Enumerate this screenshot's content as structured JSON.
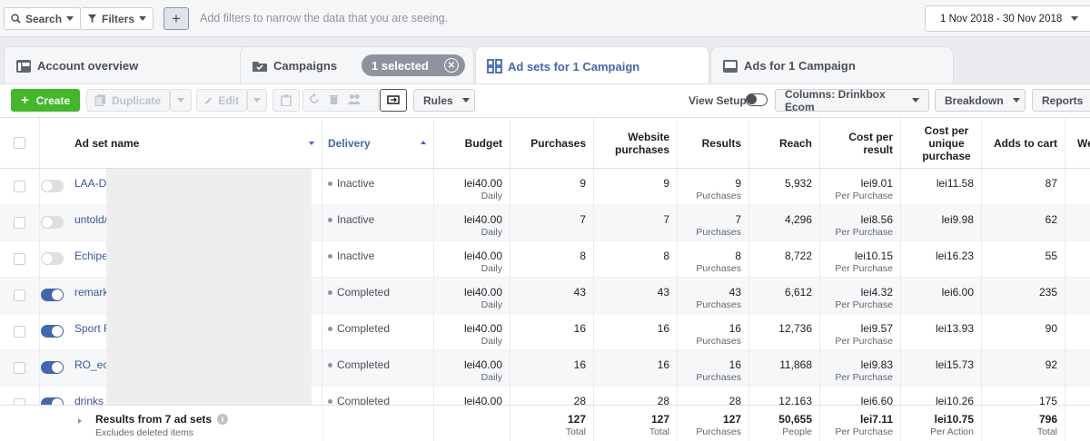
{
  "filterbar": {
    "search_label": "Search",
    "filters_label": "Filters",
    "add_label": "+",
    "hint": "Add filters to narrow the data that you are seeing.",
    "date_range": "1 Nov 2018 - 30 Nov 2018"
  },
  "tabs": {
    "account": "Account overview",
    "campaigns": "Campaigns",
    "selected": "1 selected",
    "adsets": "Ad sets for 1 Campaign",
    "ads": "Ads for 1 Campaign"
  },
  "toolbar": {
    "create": "Create",
    "duplicate": "Duplicate",
    "edit": "Edit",
    "rules": "Rules",
    "view_setup": "View Setup",
    "columns": "Columns: Drinkbox Ecom",
    "breakdown": "Breakdown",
    "reports": "Reports"
  },
  "columns": {
    "name": "Ad set name",
    "delivery": "Delivery",
    "budget": "Budget",
    "purchases": "Purchases",
    "website_purchases": "Website purchases",
    "results": "Results",
    "reach": "Reach",
    "cost_per_result": "Cost per result",
    "cost_unique": "Cost per unique purchase",
    "adds_to_cart": "Adds to cart",
    "next": "We"
  },
  "rows": [
    {
      "name": "LAA-DE",
      "on": false,
      "delivery": "Inactive",
      "budget": "lei40.00",
      "budget_sub": "Daily",
      "purchases": "9",
      "website": "9",
      "results": "9",
      "results_sub": "Purchases",
      "reach": "5,932",
      "cpr": "lei9.01",
      "cpr_sub": "Per Purchase",
      "cpu": "lei11.58",
      "cart": "87"
    },
    {
      "name": "untold/",
      "on": false,
      "delivery": "Inactive",
      "budget": "lei40.00",
      "budget_sub": "Daily",
      "purchases": "7",
      "website": "7",
      "results": "7",
      "results_sub": "Purchases",
      "reach": "4,296",
      "cpr": "lei8.56",
      "cpr_sub": "Per Purchase",
      "cpu": "lei9.98",
      "cart": "62"
    },
    {
      "name": "Echipe",
      "on": false,
      "delivery": "Inactive",
      "budget": "lei40.00",
      "budget_sub": "Daily",
      "purchases": "8",
      "website": "8",
      "results": "8",
      "results_sub": "Purchases",
      "reach": "8,722",
      "cpr": "lei10.15",
      "cpr_sub": "Per Purchase",
      "cpu": "lei16.23",
      "cart": "55"
    },
    {
      "name": "remark",
      "on": true,
      "delivery": "Completed",
      "budget": "lei40.00",
      "budget_sub": "Daily",
      "purchases": "43",
      "website": "43",
      "results": "43",
      "results_sub": "Purchases",
      "reach": "6,612",
      "cpr": "lei4.32",
      "cpr_sub": "Per Purchase",
      "cpu": "lei6.00",
      "cart": "235"
    },
    {
      "name": "Sport F",
      "on": true,
      "delivery": "Completed",
      "budget": "lei40.00",
      "budget_sub": "Daily",
      "purchases": "16",
      "website": "16",
      "results": "16",
      "results_sub": "Purchases",
      "reach": "12,736",
      "cpr": "lei9.57",
      "cpr_sub": "Per Purchase",
      "cpu": "lei13.93",
      "cart": "90"
    },
    {
      "name": "RO_ech",
      "on": true,
      "delivery": "Completed",
      "budget": "lei40.00",
      "budget_sub": "Daily",
      "purchases": "16",
      "website": "16",
      "results": "16",
      "results_sub": "Purchases",
      "reach": "11,868",
      "cpr": "lei9.83",
      "cpr_sub": "Per Purchase",
      "cpu": "lei15.73",
      "cart": "92"
    },
    {
      "name": "drinks l",
      "on": true,
      "delivery": "Completed",
      "budget": "lei40.00",
      "budget_sub": "",
      "purchases": "28",
      "website": "28",
      "results": "28",
      "results_sub": "",
      "reach": "12,163",
      "cpr": "lei6.60",
      "cpr_sub": "",
      "cpu": "lei10.26",
      "cart": "175"
    }
  ],
  "footer": {
    "title": "Results from 7 ad sets",
    "subtitle": "Excludes deleted items",
    "purchases": "127",
    "purchases_sub": "Total",
    "website": "127",
    "website_sub": "Total",
    "results": "127",
    "results_sub": "Purchases",
    "reach": "50,655",
    "reach_sub": "People",
    "cpr": "lei7.11",
    "cpr_sub": "Per Purchase",
    "cpu": "lei10.75",
    "cpu_sub": "Per Action",
    "cart": "796",
    "cart_sub": "Total"
  },
  "colors": {
    "accent": "#4267b2",
    "create": "#42b72a",
    "link": "#365899"
  }
}
